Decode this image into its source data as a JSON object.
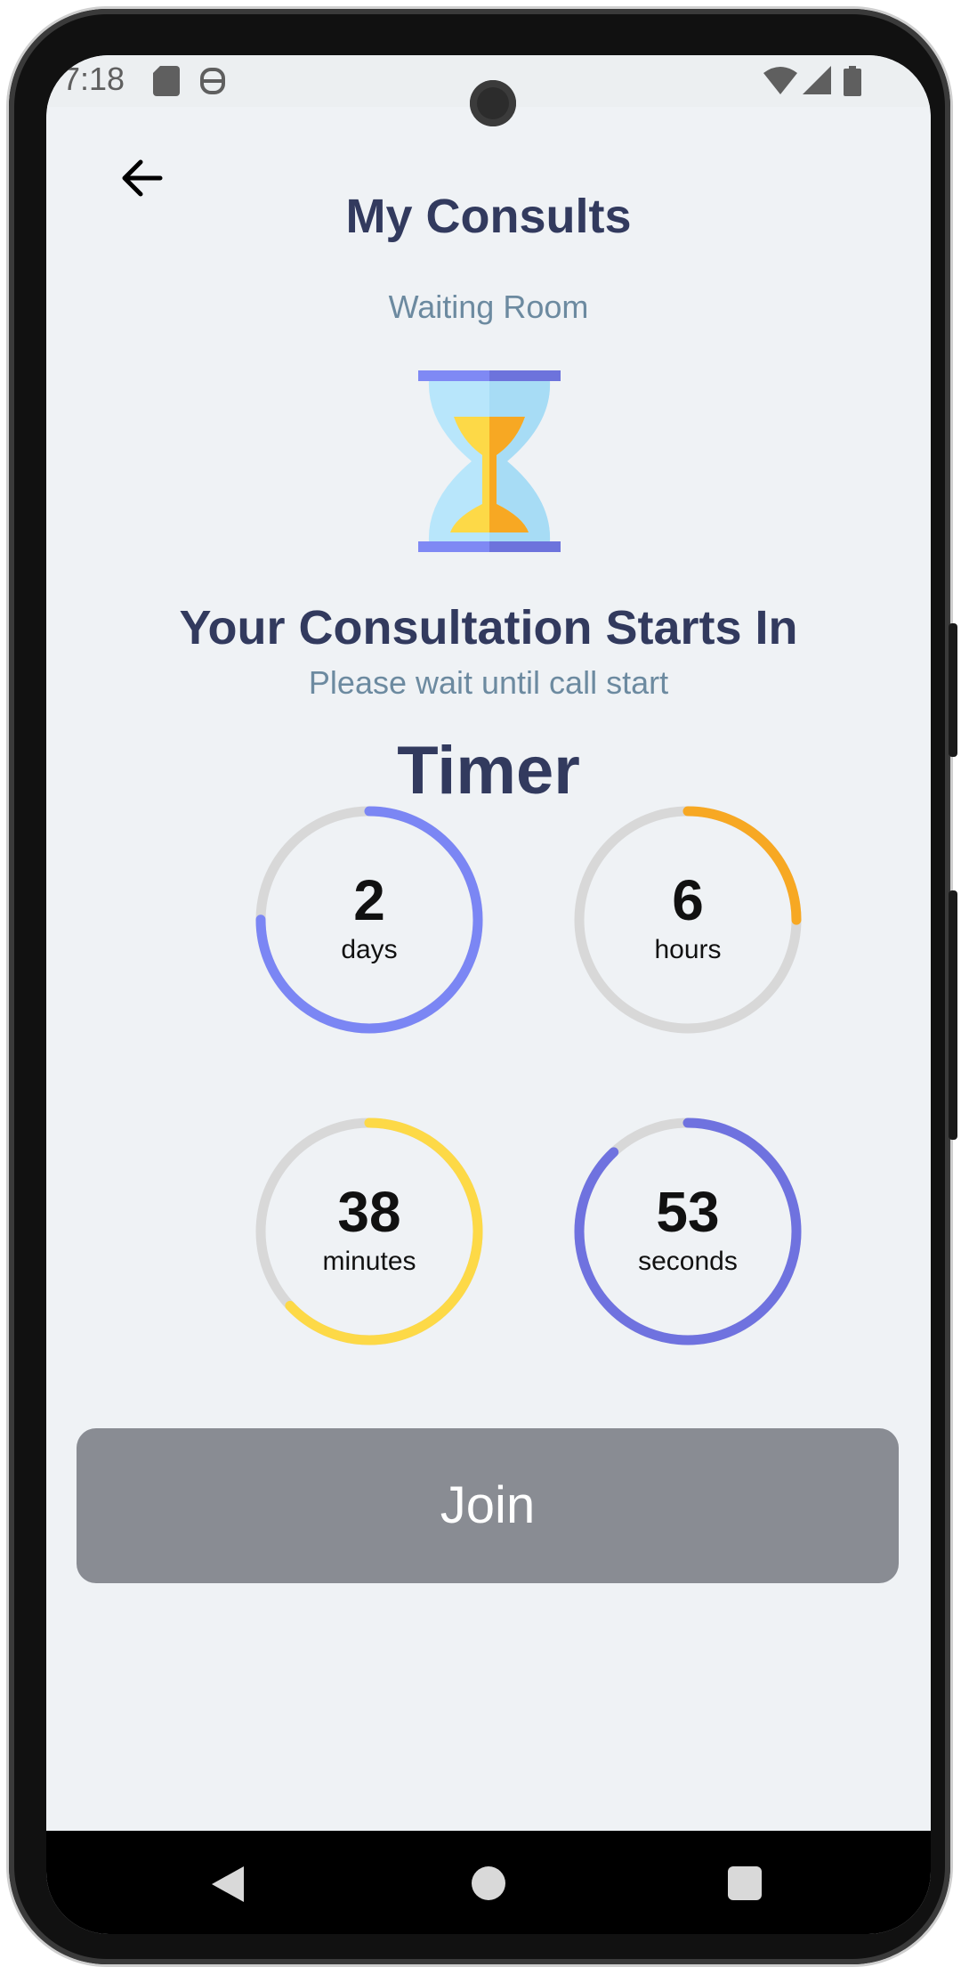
{
  "status_bar": {
    "time": "7:18"
  },
  "header": {
    "title": "My Consults",
    "subtitle": "Waiting Room"
  },
  "countdown": {
    "heading": "Your Consultation Starts In",
    "hint": "Please wait until call start",
    "timer_label": "Timer",
    "units": [
      {
        "value": "2",
        "label": "days",
        "color": "#7b86f4",
        "progress": 0.75
      },
      {
        "value": "6",
        "label": "hours",
        "color": "#f7a823",
        "progress": 0.25
      },
      {
        "value": "38",
        "label": "minutes",
        "color": "#fdd947",
        "progress": 0.63
      },
      {
        "value": "53",
        "label": "seconds",
        "color": "#6f72df",
        "progress": 0.88
      }
    ]
  },
  "actions": {
    "join_label": "Join"
  },
  "colors": {
    "primary_text": "#323a5e",
    "muted_text": "#6c8aa0",
    "track": "#d8d8d8",
    "button_disabled": "#898c93"
  }
}
